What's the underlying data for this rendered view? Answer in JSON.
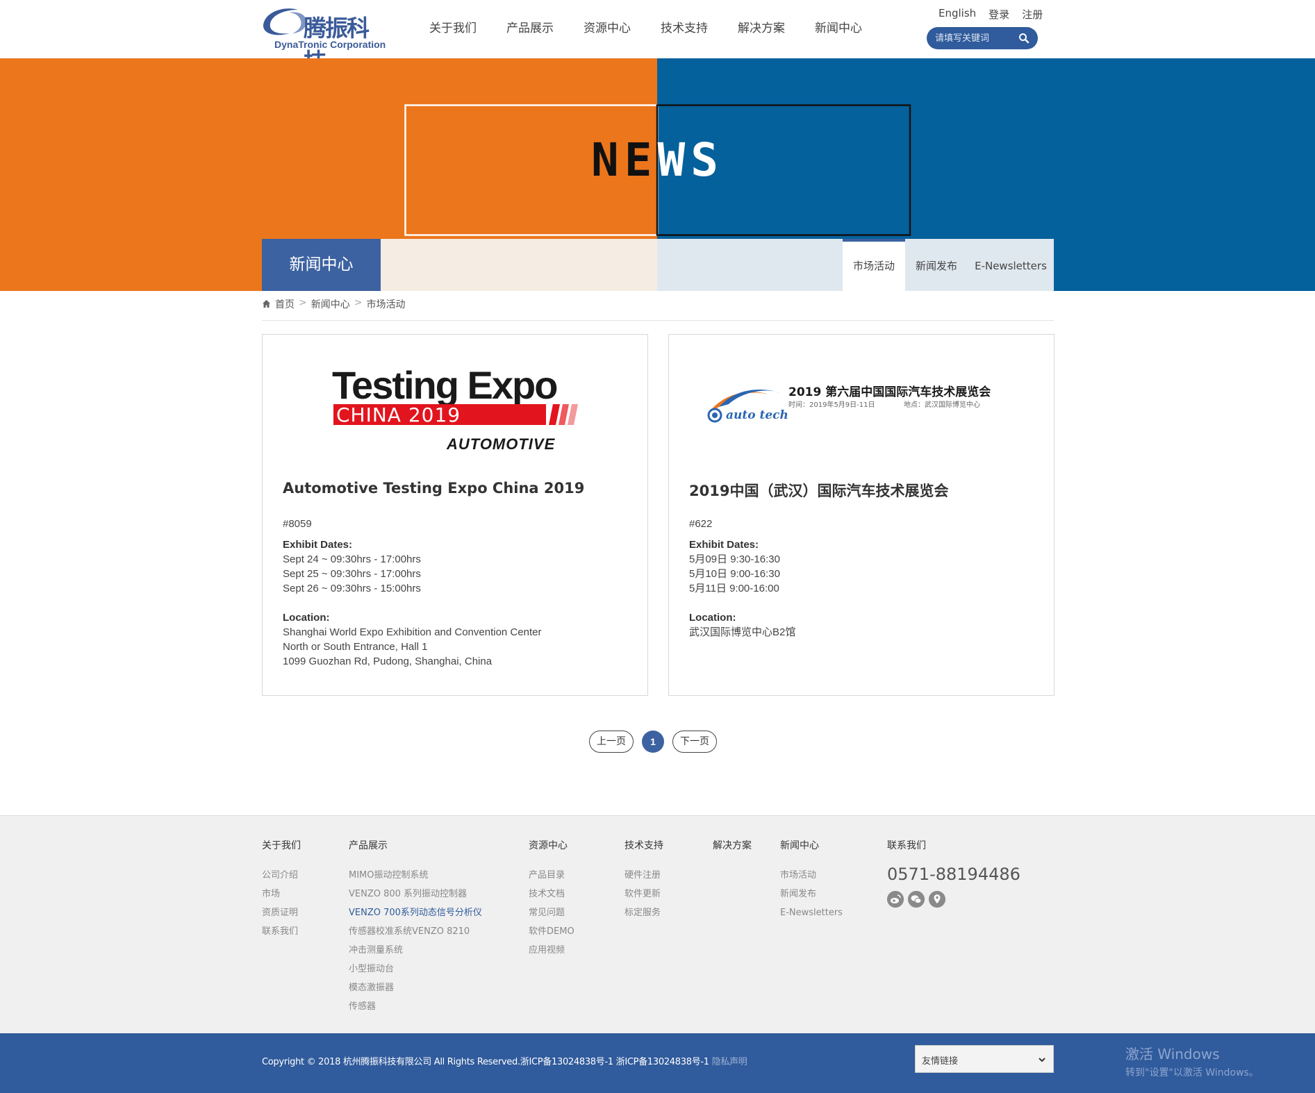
{
  "header": {
    "logo_cn": "腾振科技",
    "logo_en": "DynaTronic Corporation",
    "nav": [
      "关于我们",
      "产品展示",
      "资源中心",
      "技术支持",
      "解决方案",
      "新闻中心"
    ],
    "toplinks": {
      "english": "English",
      "login": "登录",
      "register": "注册"
    },
    "search_placeholder": "请填写关键词"
  },
  "banner": {
    "title_a": "NE",
    "title_b": "WS",
    "section": "新闻中心",
    "tabs": [
      "市场活动",
      "新闻发布",
      "E-Newsletters"
    ],
    "active_tab": "市场活动"
  },
  "breadcrumb": {
    "home": "首页",
    "level1": "新闻中心",
    "level2": "市场活动",
    "sep": ">"
  },
  "cards": [
    {
      "logo": {
        "line1": "Testing Expo",
        "line2": "CHINA 2019",
        "line3": "AUTOMOTIVE"
      },
      "title": "Automotive Testing Expo China 2019",
      "booth": "#8059",
      "dates_label": "Exhibit Dates:",
      "dates": [
        "Sept 24 ~ 09:30hrs - 17:00hrs",
        "Sept 25 ~ 09:30hrs - 17:00hrs",
        "Sept 26 ~ 09:30hrs - 15:00hrs"
      ],
      "location_label": "Location:",
      "location": [
        "Shanghai World Expo Exhibition and Convention Center",
        "North or South Entrance, Hall 1",
        "1099 Guozhan Rd, Pudong, Shanghai, China"
      ]
    },
    {
      "logo": {
        "brand": "auto tech",
        "headline": "2019 第六届中国国际汽车技术展览会",
        "sub_time": "时间：2019年5月9日-11日",
        "sub_place": "地点：武汉国际博览中心"
      },
      "title": "2019中国（武汉）国际汽车技术展览会",
      "booth": "#622",
      "dates_label": "Exhibit Dates:",
      "dates": [
        "5月09日 9:30-16:30",
        "5月10日 9:00-16:30",
        "5月11日 9:00-16:00"
      ],
      "location_label": "Location:",
      "location": [
        "武汉国际博览中心B2馆"
      ]
    }
  ],
  "pagination": {
    "prev": "上一页",
    "current": "1",
    "next": "下一页"
  },
  "footer": {
    "about": {
      "head": "关于我们",
      "links": [
        "公司介绍",
        "市场",
        "资质证明",
        "联系我们"
      ]
    },
    "products": {
      "head": "产品展示",
      "links": [
        "MIMO振动控制系统",
        "VENZO 800 系列振动控制器",
        "VENZO 700系列动态信号分析仪",
        "传感器校准系统VENZO 8210",
        "冲击测量系统",
        "小型振动台",
        "模态激振器",
        "传感器"
      ],
      "highlighted": "VENZO 700系列动态信号分析仪"
    },
    "resources": {
      "head": "资源中心",
      "links": [
        "产品目录",
        "技术文档",
        "常见问题",
        "软件DEMO",
        "应用视频"
      ]
    },
    "support": {
      "head": "技术支持",
      "links": [
        "硬件注册",
        "软件更新",
        "标定服务"
      ]
    },
    "solutions": {
      "head": "解决方案"
    },
    "news": {
      "head": "新闻中心",
      "links": [
        "市场活动",
        "新闻发布",
        "E-Newsletters"
      ]
    },
    "contact": {
      "head": "联系我们",
      "phone": "0571-88194486",
      "icons": [
        "weibo-icon",
        "wechat-icon",
        "location-icon"
      ]
    }
  },
  "bottom": {
    "copyright": "Copyright © 2018 杭州腾振科技有限公司 All Rights Reserved.浙ICP备13024838号-1 浙ICP备13024838号-1",
    "privacy": "隐私声明",
    "friend_links": "友情链接",
    "watermark_1": "激活 Windows",
    "watermark_2": "转到\"设置\"以激活 Windows。"
  },
  "colors": {
    "brand_blue": "#305b9c",
    "orange": "#ec761c",
    "banner_blue": "#04619c",
    "footer_bg": "#f0f0f0"
  }
}
